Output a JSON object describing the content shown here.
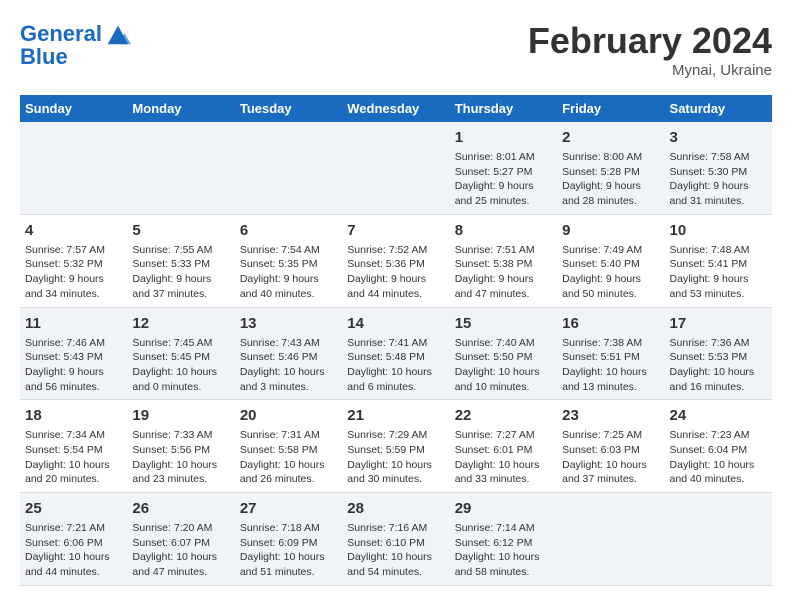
{
  "header": {
    "logo_line1": "General",
    "logo_line2": "Blue",
    "month_title": "February 2024",
    "location": "Mynai, Ukraine"
  },
  "weekdays": [
    "Sunday",
    "Monday",
    "Tuesday",
    "Wednesday",
    "Thursday",
    "Friday",
    "Saturday"
  ],
  "rows": [
    [
      {
        "day": "",
        "info": ""
      },
      {
        "day": "",
        "info": ""
      },
      {
        "day": "",
        "info": ""
      },
      {
        "day": "",
        "info": ""
      },
      {
        "day": "1",
        "info": "Sunrise: 8:01 AM\nSunset: 5:27 PM\nDaylight: 9 hours\nand 25 minutes."
      },
      {
        "day": "2",
        "info": "Sunrise: 8:00 AM\nSunset: 5:28 PM\nDaylight: 9 hours\nand 28 minutes."
      },
      {
        "day": "3",
        "info": "Sunrise: 7:58 AM\nSunset: 5:30 PM\nDaylight: 9 hours\nand 31 minutes."
      }
    ],
    [
      {
        "day": "4",
        "info": "Sunrise: 7:57 AM\nSunset: 5:32 PM\nDaylight: 9 hours\nand 34 minutes."
      },
      {
        "day": "5",
        "info": "Sunrise: 7:55 AM\nSunset: 5:33 PM\nDaylight: 9 hours\nand 37 minutes."
      },
      {
        "day": "6",
        "info": "Sunrise: 7:54 AM\nSunset: 5:35 PM\nDaylight: 9 hours\nand 40 minutes."
      },
      {
        "day": "7",
        "info": "Sunrise: 7:52 AM\nSunset: 5:36 PM\nDaylight: 9 hours\nand 44 minutes."
      },
      {
        "day": "8",
        "info": "Sunrise: 7:51 AM\nSunset: 5:38 PM\nDaylight: 9 hours\nand 47 minutes."
      },
      {
        "day": "9",
        "info": "Sunrise: 7:49 AM\nSunset: 5:40 PM\nDaylight: 9 hours\nand 50 minutes."
      },
      {
        "day": "10",
        "info": "Sunrise: 7:48 AM\nSunset: 5:41 PM\nDaylight: 9 hours\nand 53 minutes."
      }
    ],
    [
      {
        "day": "11",
        "info": "Sunrise: 7:46 AM\nSunset: 5:43 PM\nDaylight: 9 hours\nand 56 minutes."
      },
      {
        "day": "12",
        "info": "Sunrise: 7:45 AM\nSunset: 5:45 PM\nDaylight: 10 hours\nand 0 minutes."
      },
      {
        "day": "13",
        "info": "Sunrise: 7:43 AM\nSunset: 5:46 PM\nDaylight: 10 hours\nand 3 minutes."
      },
      {
        "day": "14",
        "info": "Sunrise: 7:41 AM\nSunset: 5:48 PM\nDaylight: 10 hours\nand 6 minutes."
      },
      {
        "day": "15",
        "info": "Sunrise: 7:40 AM\nSunset: 5:50 PM\nDaylight: 10 hours\nand 10 minutes."
      },
      {
        "day": "16",
        "info": "Sunrise: 7:38 AM\nSunset: 5:51 PM\nDaylight: 10 hours\nand 13 minutes."
      },
      {
        "day": "17",
        "info": "Sunrise: 7:36 AM\nSunset: 5:53 PM\nDaylight: 10 hours\nand 16 minutes."
      }
    ],
    [
      {
        "day": "18",
        "info": "Sunrise: 7:34 AM\nSunset: 5:54 PM\nDaylight: 10 hours\nand 20 minutes."
      },
      {
        "day": "19",
        "info": "Sunrise: 7:33 AM\nSunset: 5:56 PM\nDaylight: 10 hours\nand 23 minutes."
      },
      {
        "day": "20",
        "info": "Sunrise: 7:31 AM\nSunset: 5:58 PM\nDaylight: 10 hours\nand 26 minutes."
      },
      {
        "day": "21",
        "info": "Sunrise: 7:29 AM\nSunset: 5:59 PM\nDaylight: 10 hours\nand 30 minutes."
      },
      {
        "day": "22",
        "info": "Sunrise: 7:27 AM\nSunset: 6:01 PM\nDaylight: 10 hours\nand 33 minutes."
      },
      {
        "day": "23",
        "info": "Sunrise: 7:25 AM\nSunset: 6:03 PM\nDaylight: 10 hours\nand 37 minutes."
      },
      {
        "day": "24",
        "info": "Sunrise: 7:23 AM\nSunset: 6:04 PM\nDaylight: 10 hours\nand 40 minutes."
      }
    ],
    [
      {
        "day": "25",
        "info": "Sunrise: 7:21 AM\nSunset: 6:06 PM\nDaylight: 10 hours\nand 44 minutes."
      },
      {
        "day": "26",
        "info": "Sunrise: 7:20 AM\nSunset: 6:07 PM\nDaylight: 10 hours\nand 47 minutes."
      },
      {
        "day": "27",
        "info": "Sunrise: 7:18 AM\nSunset: 6:09 PM\nDaylight: 10 hours\nand 51 minutes."
      },
      {
        "day": "28",
        "info": "Sunrise: 7:16 AM\nSunset: 6:10 PM\nDaylight: 10 hours\nand 54 minutes."
      },
      {
        "day": "29",
        "info": "Sunrise: 7:14 AM\nSunset: 6:12 PM\nDaylight: 10 hours\nand 58 minutes."
      },
      {
        "day": "",
        "info": ""
      },
      {
        "day": "",
        "info": ""
      }
    ]
  ]
}
